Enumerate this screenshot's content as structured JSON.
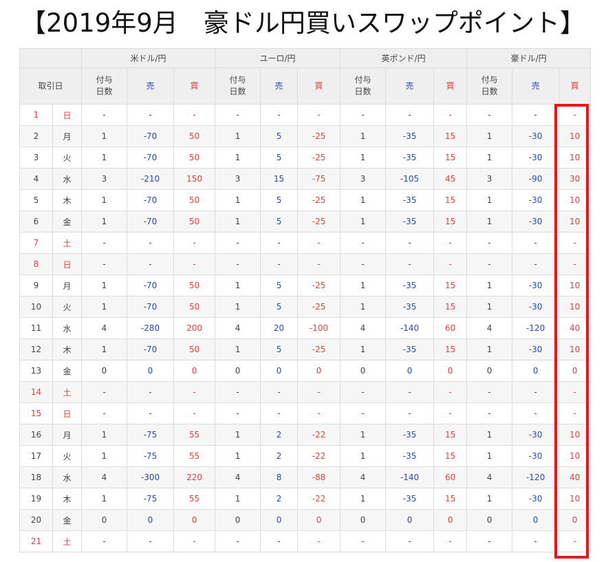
{
  "title": "【2019年9月　豪ドル円買いスワップポイント】",
  "highlight_color": "#e8161b",
  "colors": {
    "sell": "#2b4aa8",
    "buy": "#e04040",
    "header_bg": "#efefef"
  },
  "header": {
    "trade_date": "取引日",
    "days_label": "付与\n日数",
    "sell": "売",
    "buy": "買",
    "currencies": [
      "米ドル/円",
      "ユーロ/円",
      "英ポンド/円",
      "豪ドル/円"
    ]
  },
  "rows": [
    {
      "day": "1",
      "dow": "日",
      "holiday": true,
      "usd": [
        "-",
        "-",
        "-"
      ],
      "eur": [
        "-",
        "-",
        "-"
      ],
      "gbp": [
        "-",
        "-",
        "-"
      ],
      "aud": [
        "-",
        "-",
        "-"
      ]
    },
    {
      "day": "2",
      "dow": "月",
      "holiday": false,
      "usd": [
        "1",
        "-70",
        "50"
      ],
      "eur": [
        "1",
        "5",
        "-25"
      ],
      "gbp": [
        "1",
        "-35",
        "15"
      ],
      "aud": [
        "1",
        "-30",
        "10"
      ]
    },
    {
      "day": "3",
      "dow": "火",
      "holiday": false,
      "usd": [
        "1",
        "-70",
        "50"
      ],
      "eur": [
        "1",
        "5",
        "-25"
      ],
      "gbp": [
        "1",
        "-35",
        "15"
      ],
      "aud": [
        "1",
        "-30",
        "10"
      ]
    },
    {
      "day": "4",
      "dow": "水",
      "holiday": false,
      "usd": [
        "3",
        "-210",
        "150"
      ],
      "eur": [
        "3",
        "15",
        "-75"
      ],
      "gbp": [
        "3",
        "-105",
        "45"
      ],
      "aud": [
        "3",
        "-90",
        "30"
      ]
    },
    {
      "day": "5",
      "dow": "木",
      "holiday": false,
      "usd": [
        "1",
        "-70",
        "50"
      ],
      "eur": [
        "1",
        "5",
        "-25"
      ],
      "gbp": [
        "1",
        "-35",
        "15"
      ],
      "aud": [
        "1",
        "-30",
        "10"
      ]
    },
    {
      "day": "6",
      "dow": "金",
      "holiday": false,
      "usd": [
        "1",
        "-70",
        "50"
      ],
      "eur": [
        "1",
        "5",
        "-25"
      ],
      "gbp": [
        "1",
        "-35",
        "15"
      ],
      "aud": [
        "1",
        "-30",
        "10"
      ]
    },
    {
      "day": "7",
      "dow": "土",
      "holiday": true,
      "usd": [
        "-",
        "-",
        "-"
      ],
      "eur": [
        "-",
        "-",
        "-"
      ],
      "gbp": [
        "-",
        "-",
        "-"
      ],
      "aud": [
        "-",
        "-",
        "-"
      ]
    },
    {
      "day": "8",
      "dow": "日",
      "holiday": true,
      "usd": [
        "-",
        "-",
        "-"
      ],
      "eur": [
        "-",
        "-",
        "-"
      ],
      "gbp": [
        "-",
        "-",
        "-"
      ],
      "aud": [
        "-",
        "-",
        "-"
      ]
    },
    {
      "day": "9",
      "dow": "月",
      "holiday": false,
      "usd": [
        "1",
        "-70",
        "50"
      ],
      "eur": [
        "1",
        "5",
        "-25"
      ],
      "gbp": [
        "1",
        "-35",
        "15"
      ],
      "aud": [
        "1",
        "-30",
        "10"
      ]
    },
    {
      "day": "10",
      "dow": "火",
      "holiday": false,
      "usd": [
        "1",
        "-70",
        "50"
      ],
      "eur": [
        "1",
        "5",
        "-25"
      ],
      "gbp": [
        "1",
        "-35",
        "15"
      ],
      "aud": [
        "1",
        "-30",
        "10"
      ]
    },
    {
      "day": "11",
      "dow": "水",
      "holiday": false,
      "usd": [
        "4",
        "-280",
        "200"
      ],
      "eur": [
        "4",
        "20",
        "-100"
      ],
      "gbp": [
        "4",
        "-140",
        "60"
      ],
      "aud": [
        "4",
        "-120",
        "40"
      ]
    },
    {
      "day": "12",
      "dow": "木",
      "holiday": false,
      "usd": [
        "1",
        "-70",
        "50"
      ],
      "eur": [
        "1",
        "5",
        "-25"
      ],
      "gbp": [
        "1",
        "-35",
        "15"
      ],
      "aud": [
        "1",
        "-30",
        "10"
      ]
    },
    {
      "day": "13",
      "dow": "金",
      "holiday": false,
      "usd": [
        "0",
        "0",
        "0"
      ],
      "eur": [
        "0",
        "0",
        "0"
      ],
      "gbp": [
        "0",
        "0",
        "0"
      ],
      "aud": [
        "0",
        "0",
        "0"
      ]
    },
    {
      "day": "14",
      "dow": "土",
      "holiday": true,
      "usd": [
        "-",
        "-",
        "-"
      ],
      "eur": [
        "-",
        "-",
        "-"
      ],
      "gbp": [
        "-",
        "-",
        "-"
      ],
      "aud": [
        "-",
        "-",
        "-"
      ]
    },
    {
      "day": "15",
      "dow": "日",
      "holiday": true,
      "usd": [
        "-",
        "-",
        "-"
      ],
      "eur": [
        "-",
        "-",
        "-"
      ],
      "gbp": [
        "-",
        "-",
        "-"
      ],
      "aud": [
        "-",
        "-",
        "-"
      ]
    },
    {
      "day": "16",
      "dow": "月",
      "holiday": false,
      "usd": [
        "1",
        "-75",
        "55"
      ],
      "eur": [
        "1",
        "2",
        "-22"
      ],
      "gbp": [
        "1",
        "-35",
        "15"
      ],
      "aud": [
        "1",
        "-30",
        "10"
      ]
    },
    {
      "day": "17",
      "dow": "火",
      "holiday": false,
      "usd": [
        "1",
        "-75",
        "55"
      ],
      "eur": [
        "1",
        "2",
        "-22"
      ],
      "gbp": [
        "1",
        "-35",
        "15"
      ],
      "aud": [
        "1",
        "-30",
        "10"
      ]
    },
    {
      "day": "18",
      "dow": "水",
      "holiday": false,
      "usd": [
        "4",
        "-300",
        "220"
      ],
      "eur": [
        "4",
        "8",
        "-88"
      ],
      "gbp": [
        "4",
        "-140",
        "60"
      ],
      "aud": [
        "4",
        "-120",
        "40"
      ]
    },
    {
      "day": "19",
      "dow": "木",
      "holiday": false,
      "usd": [
        "1",
        "-75",
        "55"
      ],
      "eur": [
        "1",
        "2",
        "-22"
      ],
      "gbp": [
        "1",
        "-35",
        "15"
      ],
      "aud": [
        "1",
        "-30",
        "10"
      ]
    },
    {
      "day": "20",
      "dow": "金",
      "holiday": false,
      "usd": [
        "0",
        "0",
        "0"
      ],
      "eur": [
        "0",
        "0",
        "0"
      ],
      "gbp": [
        "0",
        "0",
        "0"
      ],
      "aud": [
        "0",
        "0",
        "0"
      ]
    },
    {
      "day": "21",
      "dow": "土",
      "holiday": true,
      "usd": [
        "-",
        "-",
        "-"
      ],
      "eur": [
        "-",
        "-",
        "-"
      ],
      "gbp": [
        "-",
        "-",
        "-"
      ],
      "aud": [
        "-",
        "-",
        "-"
      ]
    }
  ]
}
